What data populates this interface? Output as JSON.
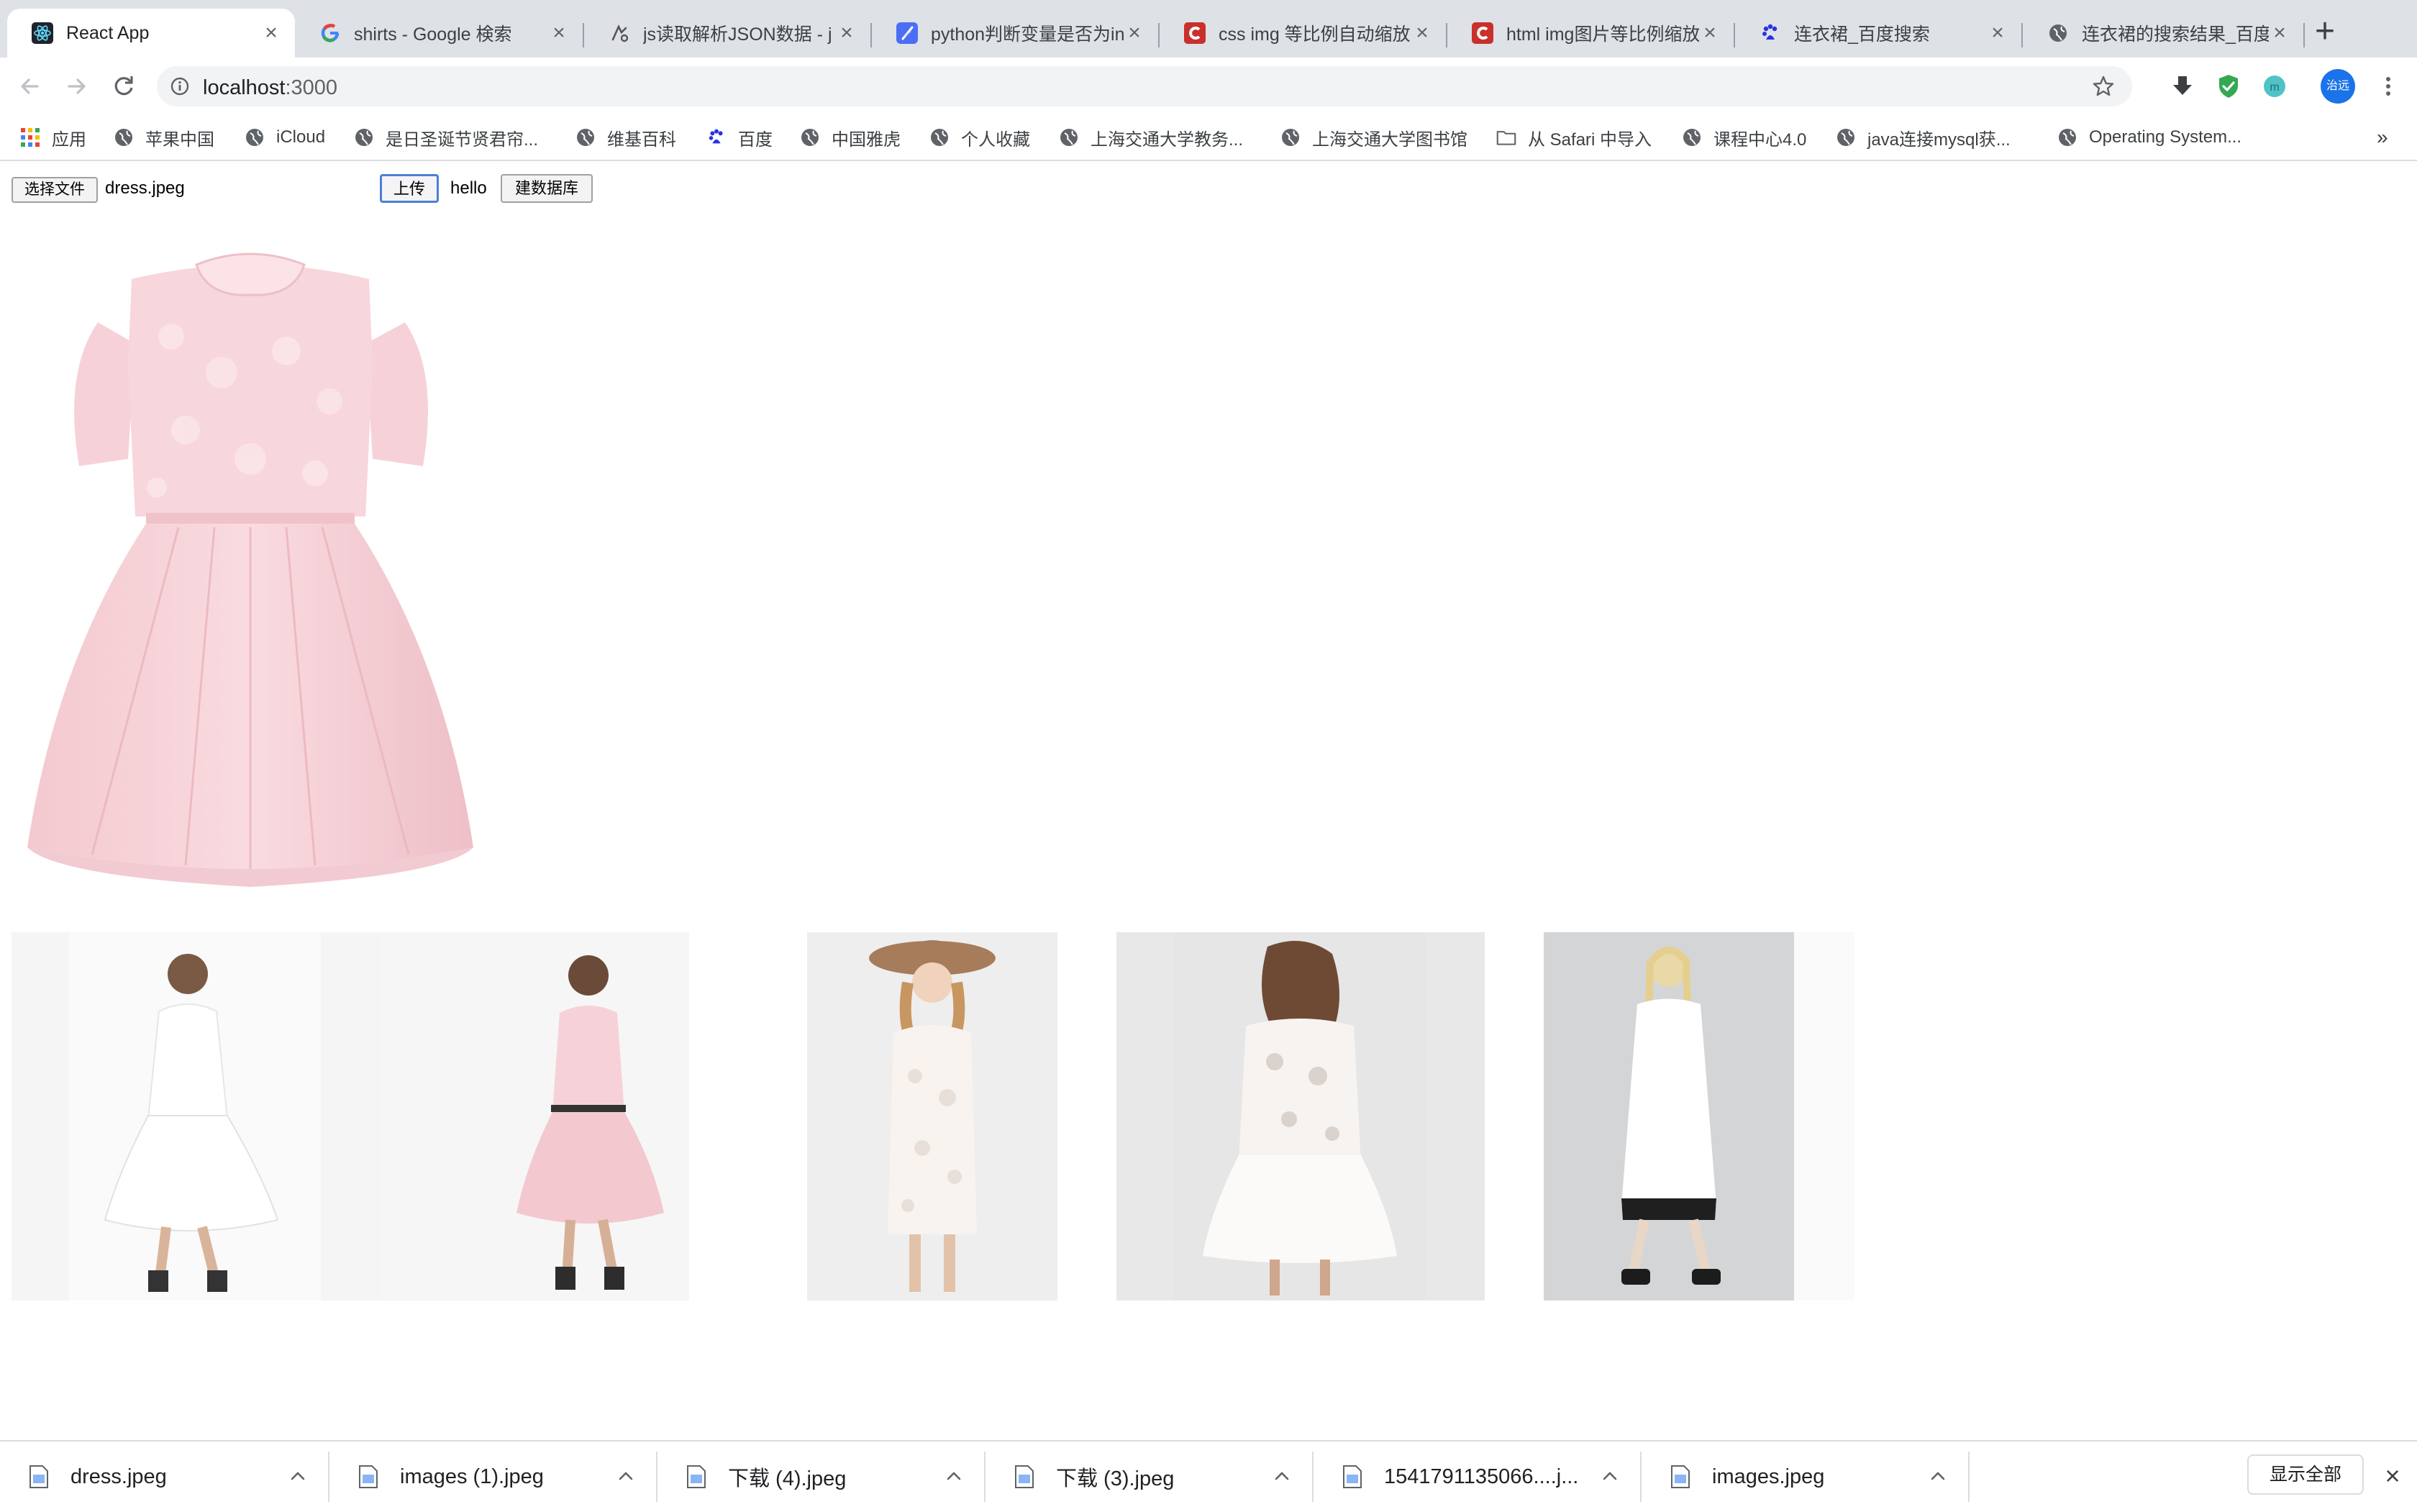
{
  "browser": {
    "tabs": [
      {
        "title": "React App",
        "icon": "react-icon",
        "active": true
      },
      {
        "title": "shirts - Google 検索",
        "icon": "google-icon"
      },
      {
        "title": "js读取解析JSON数据 - j",
        "icon": "jianshu-icon"
      },
      {
        "title": "python判断变量是否为in",
        "icon": "feather-icon"
      },
      {
        "title": "css img 等比例自动缩放",
        "icon": "csdn-icon"
      },
      {
        "title": "html img图片等比例缩放",
        "icon": "csdn-icon"
      },
      {
        "title": "连衣裙_百度搜索",
        "icon": "baidu-paw-icon"
      },
      {
        "title": "连衣裙的搜索结果_百度图",
        "icon": "globe-icon"
      }
    ],
    "close_glyph": "×",
    "new_tab_glyph": "+",
    "address": {
      "host": "localhost",
      "port": ":3000"
    },
    "profile_label": "治远",
    "colors": {
      "tabstrip": "#dee1e6",
      "omnibox": "#f1f3f4",
      "shield": "#34a853",
      "avatar": "#1a73e8"
    }
  },
  "bookmarks": [
    {
      "label": "应用",
      "icon": "apps-grid-icon"
    },
    {
      "label": "苹果中国",
      "icon": "globe-icon"
    },
    {
      "label": "iCloud",
      "icon": "globe-icon"
    },
    {
      "label": "是日圣诞节贤君帘...",
      "icon": "globe-icon"
    },
    {
      "label": "维基百科",
      "icon": "globe-icon"
    },
    {
      "label": "百度",
      "icon": "baidu-paw-icon"
    },
    {
      "label": "中国雅虎",
      "icon": "globe-icon"
    },
    {
      "label": "个人收藏",
      "icon": "globe-icon"
    },
    {
      "label": "上海交通大学教务...",
      "icon": "globe-icon"
    },
    {
      "label": "上海交通大学图书馆",
      "icon": "globe-icon"
    },
    {
      "label": "从 Safari 中导入",
      "icon": "folder-icon"
    },
    {
      "label": "课程中心4.0",
      "icon": "globe-icon"
    },
    {
      "label": "java连接mysql获...",
      "icon": "globe-icon"
    },
    {
      "label": "Operating System...",
      "icon": "globe-icon"
    }
  ],
  "bookmarks_overflow": "»",
  "page": {
    "choose_file_label": "选择文件",
    "chosen_file": "dress.jpeg",
    "upload_label": "上传",
    "hello_text": "hello",
    "build_db_label": "建数据库",
    "results_count": 5
  },
  "downloads": [
    {
      "name": "dress.jpeg"
    },
    {
      "name": "images (1).jpeg"
    },
    {
      "name": "下载 (4).jpeg"
    },
    {
      "name": "下载 (3).jpeg"
    },
    {
      "name": "1541791135066....j..."
    },
    {
      "name": "images.jpeg"
    }
  ],
  "show_all_label": "显示全部"
}
